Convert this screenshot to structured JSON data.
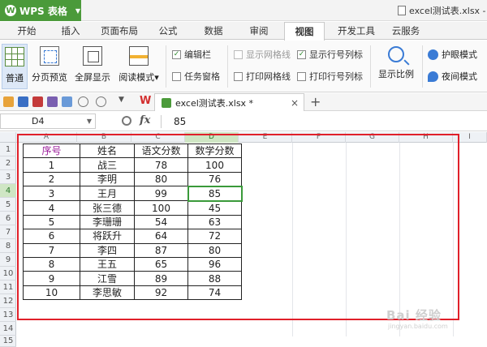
{
  "app": {
    "name": "WPS 表格",
    "logo": "W"
  },
  "document": {
    "filename": "excel测试表.xlsx - "
  },
  "menu": {
    "tabs": [
      "开始",
      "插入",
      "页面布局",
      "公式",
      "数据",
      "审阅",
      "视图",
      "开发工具",
      "云服务"
    ],
    "active": "视图"
  },
  "ribbon": {
    "normal": "普通",
    "page_break": "分页预览",
    "full_screen": "全屏显示",
    "reading_mode": "阅读模式",
    "reading_mode_caret": "▾",
    "checks": [
      {
        "label": "编辑栏",
        "checked": true,
        "mark": "✓"
      },
      {
        "label": "任务窗格",
        "checked": false,
        "mark": ""
      },
      {
        "label": "显示网格线",
        "checked": false,
        "mark": ""
      },
      {
        "label": "显示行号列标",
        "checked": true,
        "mark": "✓"
      },
      {
        "label": "打印网格线",
        "checked": false,
        "mark": ""
      },
      {
        "label": "打印行号列标",
        "checked": false,
        "mark": ""
      }
    ],
    "zoom": "显示比例",
    "eye_mode": "护眼模式",
    "night_mode": "夜间模式"
  },
  "toolbar": {
    "file_tab": "excel测试表.xlsx *",
    "close": "×",
    "add": "+"
  },
  "formula_bar": {
    "cell_ref": "D4",
    "fx": "fx",
    "value": "85"
  },
  "columns": [
    "A",
    "B",
    "C",
    "D",
    "E",
    "F",
    "G",
    "H",
    "I"
  ],
  "rows": [
    "1",
    "2",
    "3",
    "4",
    "5",
    "6",
    "7",
    "8",
    "9",
    "10",
    "11",
    "12",
    "13",
    "14",
    "15"
  ],
  "table": {
    "headers": [
      "序号",
      "姓名",
      "语文分数",
      "数学分数"
    ],
    "rows": [
      [
        "1",
        "战三",
        "78",
        "100"
      ],
      [
        "2",
        "李明",
        "80",
        "76"
      ],
      [
        "3",
        "王月",
        "99",
        "85"
      ],
      [
        "4",
        "张三德",
        "100",
        "45"
      ],
      [
        "5",
        "李珊珊",
        "54",
        "63"
      ],
      [
        "6",
        "将跃升",
        "64",
        "72"
      ],
      [
        "7",
        "李四",
        "87",
        "80"
      ],
      [
        "8",
        "王五",
        "65",
        "96"
      ],
      [
        "9",
        "江雪",
        "89",
        "88"
      ],
      [
        "10",
        "李思敏",
        "92",
        "74"
      ]
    ]
  },
  "watermark": {
    "text": "Bai 经验",
    "sub": "jingyan.baidu.com"
  },
  "colors": {
    "brand": "#4b9a3a",
    "highlight_box": "#e0202a",
    "header_text": "#9b1d9b",
    "active_cell": "#3a9a3a"
  }
}
